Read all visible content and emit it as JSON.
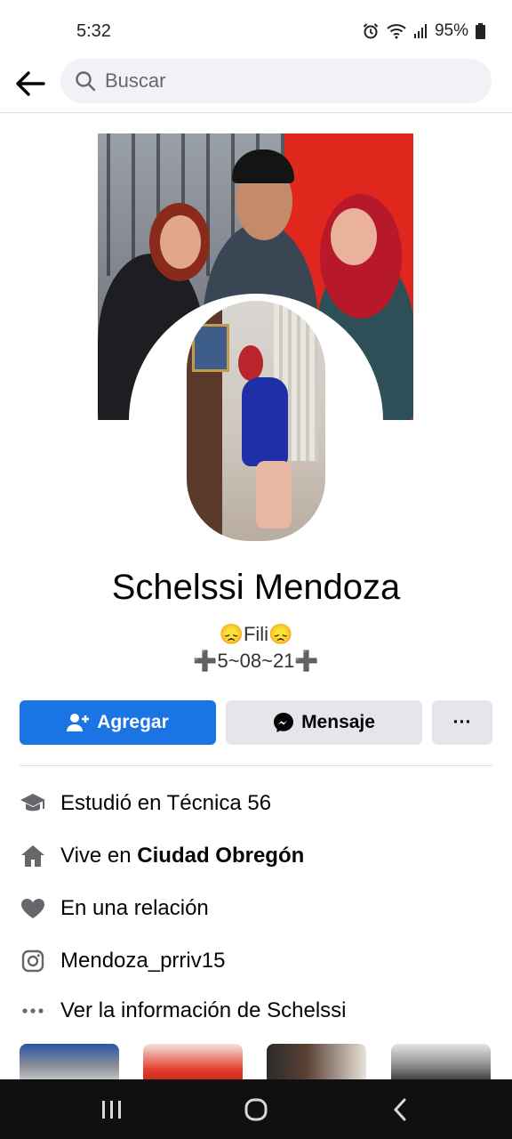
{
  "status_bar": {
    "time": "5:32",
    "battery": "95%"
  },
  "header": {
    "search_placeholder": "Buscar"
  },
  "profile": {
    "name": "Schelssi Mendoza",
    "bio_line1": "😞Fili😞",
    "bio_line2": "➕5~08~21➕"
  },
  "actions": {
    "add_label": "Agregar",
    "message_label": "Mensaje",
    "more_label": "···"
  },
  "details": {
    "studied": "Estudió en Técnica 56",
    "lives_prefix": "Vive en ",
    "lives_city": "Ciudad Obregón",
    "relationship": "En una relación",
    "instagram": "Mendoza_prriv15",
    "see_info": "Ver la información de Schelssi"
  },
  "colors": {
    "primary": "#1b74e4",
    "secondary_button": "#e4e6eb",
    "search_bg": "#f0f2f5"
  }
}
